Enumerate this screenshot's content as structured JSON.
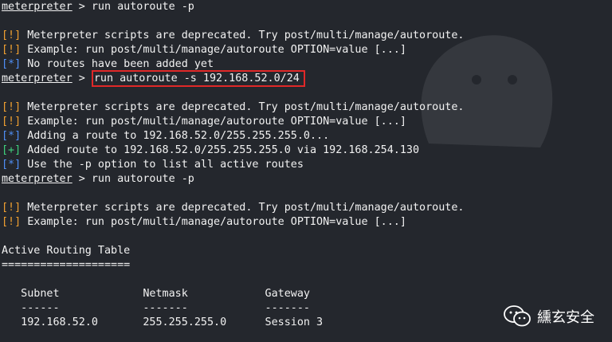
{
  "prompt_label": "meterpreter",
  "prompt_sep": " > ",
  "lines": [
    {
      "kind": "cmd",
      "text": "run autoroute -p",
      "boxed": false
    },
    {
      "kind": "blank"
    },
    {
      "kind": "msg",
      "tag": "[!]",
      "tag_type": "warn",
      "text": " Meterpreter scripts are deprecated. Try post/multi/manage/autoroute."
    },
    {
      "kind": "msg",
      "tag": "[!]",
      "tag_type": "warn",
      "text": " Example: run post/multi/manage/autoroute OPTION=value [...]"
    },
    {
      "kind": "msg",
      "tag": "[*]",
      "tag_type": "info",
      "text": " No routes have been added yet"
    },
    {
      "kind": "cmd",
      "text": "run autoroute -s 192.168.52.0/24",
      "boxed": true
    },
    {
      "kind": "blank"
    },
    {
      "kind": "msg",
      "tag": "[!]",
      "tag_type": "warn",
      "text": " Meterpreter scripts are deprecated. Try post/multi/manage/autoroute."
    },
    {
      "kind": "msg",
      "tag": "[!]",
      "tag_type": "warn",
      "text": " Example: run post/multi/manage/autoroute OPTION=value [...]"
    },
    {
      "kind": "msg",
      "tag": "[*]",
      "tag_type": "info",
      "text": " Adding a route to 192.168.52.0/255.255.255.0..."
    },
    {
      "kind": "msg",
      "tag": "[+]",
      "tag_type": "ok",
      "text": " Added route to 192.168.52.0/255.255.255.0 via 192.168.254.130"
    },
    {
      "kind": "msg",
      "tag": "[*]",
      "tag_type": "info",
      "text": " Use the -p option to list all active routes"
    },
    {
      "kind": "cmd",
      "text": "run autoroute -p",
      "boxed": false
    },
    {
      "kind": "blank"
    },
    {
      "kind": "msg",
      "tag": "[!]",
      "tag_type": "warn",
      "text": " Meterpreter scripts are deprecated. Try post/multi/manage/autoroute."
    },
    {
      "kind": "msg",
      "tag": "[!]",
      "tag_type": "warn",
      "text": " Example: run post/multi/manage/autoroute OPTION=value [...]"
    },
    {
      "kind": "blank"
    },
    {
      "kind": "text",
      "text": "Active Routing Table"
    },
    {
      "kind": "text",
      "text": "===================="
    },
    {
      "kind": "blank"
    },
    {
      "kind": "text",
      "text": "   Subnet             Netmask            Gateway"
    },
    {
      "kind": "text",
      "text": "   ------             -------            -------"
    },
    {
      "kind": "text",
      "text": "   192.168.52.0       255.255.255.0      Session 3"
    }
  ],
  "watermark": {
    "text": "纁玄安全",
    "icon": "wechat-icon"
  },
  "colors": {
    "background": "#24272d",
    "warn": "#f0a030",
    "info": "#4f8ff7",
    "ok": "#3fd17c",
    "highlight_box": "#e02828"
  }
}
